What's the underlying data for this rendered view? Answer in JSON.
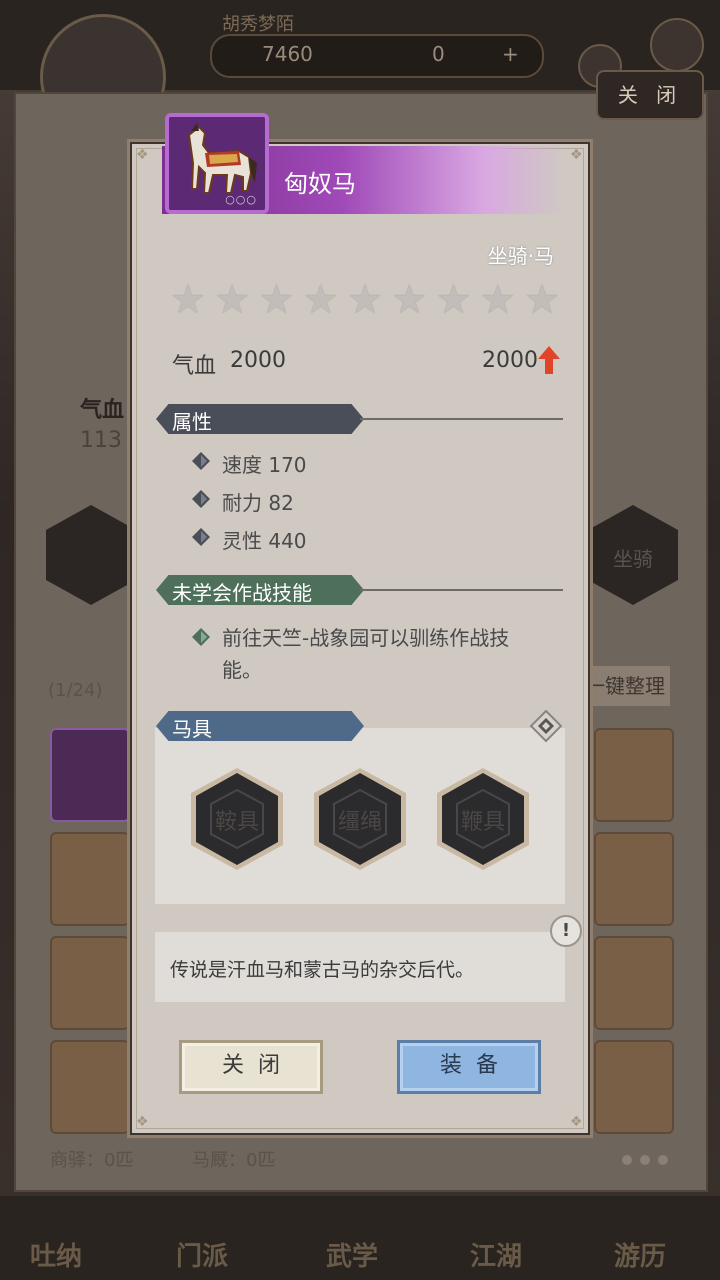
{
  "background": {
    "resource_title": "胡秀梦陌",
    "silver": "7460",
    "jade": "0",
    "plus": "+",
    "close_label": "关 闭",
    "left_stat_label": "气血",
    "left_stat_value": "113",
    "right_hex_label": "坐骑",
    "count": "(1/24)",
    "sort_label": "一键整理",
    "stable_label": "商驿：0匹",
    "stable2_label": "马厩：0匹",
    "nav": [
      "吐纳",
      "门派",
      "武学",
      "江湖",
      "游历"
    ]
  },
  "item": {
    "name": "匈奴马",
    "type": "坐骑·马",
    "icon": "horse-icon",
    "rarity_color": "#7c2f90",
    "star_count": 9,
    "hp_label": "气血",
    "hp_value": "2000",
    "hp_compare": "2000",
    "hp_trend": "up"
  },
  "sections": {
    "attributes_title": "属性",
    "attributes": [
      {
        "label": "速度 170"
      },
      {
        "label": "耐力 82"
      },
      {
        "label": "灵性 440"
      }
    ],
    "skills_title": "未学会作战技能",
    "skills_text": "前往天竺-战象园可以驯练作战技能。",
    "gear_title": "马具",
    "gear_slots": [
      "鞍具",
      "缰绳",
      "鞭具"
    ],
    "description": "传说是汗血马和蒙古马的杂交后代。",
    "info_symbol": "!"
  },
  "buttons": {
    "close": "关闭",
    "equip": "装备"
  },
  "colors": {
    "attr_header": "#4a4e58",
    "skill_header": "#4e6f5a",
    "gear_header": "#4e6a88",
    "up_arrow": "#e0452a",
    "equip_button": "#8fb6e0"
  }
}
